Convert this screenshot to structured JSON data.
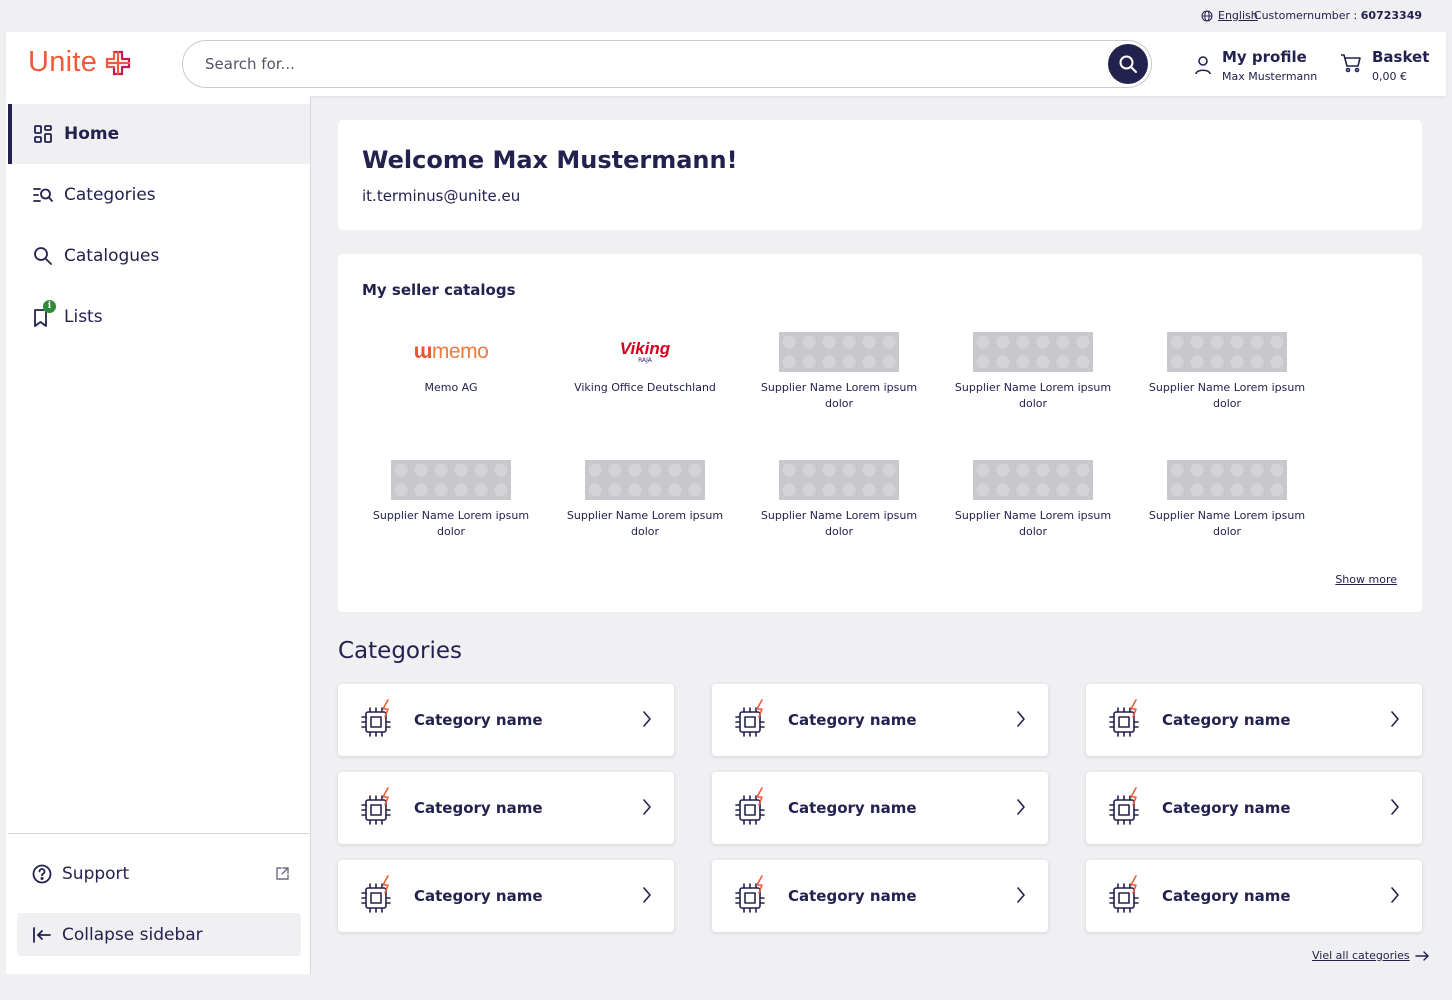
{
  "utility_bar": {
    "language": "English",
    "customer_label": "Customernumber : ",
    "customer_number": "60723349"
  },
  "header": {
    "logo_text": "Unite",
    "search_placeholder": "Search for...",
    "profile_title": "My profile",
    "profile_name": "Max Mustermann",
    "basket_title": "Basket",
    "basket_total": "0,00 €"
  },
  "sidebar": {
    "items": [
      {
        "label": "Home",
        "icon": "grid-icon",
        "active": true
      },
      {
        "label": "Categories",
        "icon": "list-search-icon"
      },
      {
        "label": "Catalogues",
        "icon": "search-icon"
      },
      {
        "label": "Lists",
        "icon": "bookmark-icon",
        "badge": "i"
      }
    ],
    "support_label": "Support",
    "collapse_label": "Collapse sidebar"
  },
  "welcome": {
    "title": "Welcome Max Mustermann!",
    "email": "it.terminus@unite.eu"
  },
  "sellers": {
    "heading": "My seller catalogs",
    "memo_logo": "memo",
    "viking_logo": "Viking",
    "viking_sub": "RAJA",
    "suppliers": [
      "Memo AG",
      "Viking Office Deutschland",
      "Supplier Name Lorem ipsum dolor",
      "Supplier Name Lorem ipsum dolor",
      "Supplier Name Lorem ipsum dolor",
      "Supplier Name Lorem ipsum dolor",
      "Supplier Name Lorem ipsum dolor",
      "Supplier Name Lorem ipsum dolor",
      "Supplier Name Lorem ipsum dolor",
      "Supplier Name Lorem ipsum dolor"
    ],
    "show_more": "Show more"
  },
  "categories": {
    "heading": "Categories",
    "items": [
      "Category name",
      "Category name",
      "Category name",
      "Category name",
      "Category name",
      "Category name",
      "Category name",
      "Category name",
      "Category name"
    ],
    "view_all": "Viel all categories"
  },
  "colors": {
    "navy": "#23224f",
    "brand_orange": "#ef5b3a",
    "brand_magenta": "#c2185b",
    "background": "#f0f0f3"
  }
}
